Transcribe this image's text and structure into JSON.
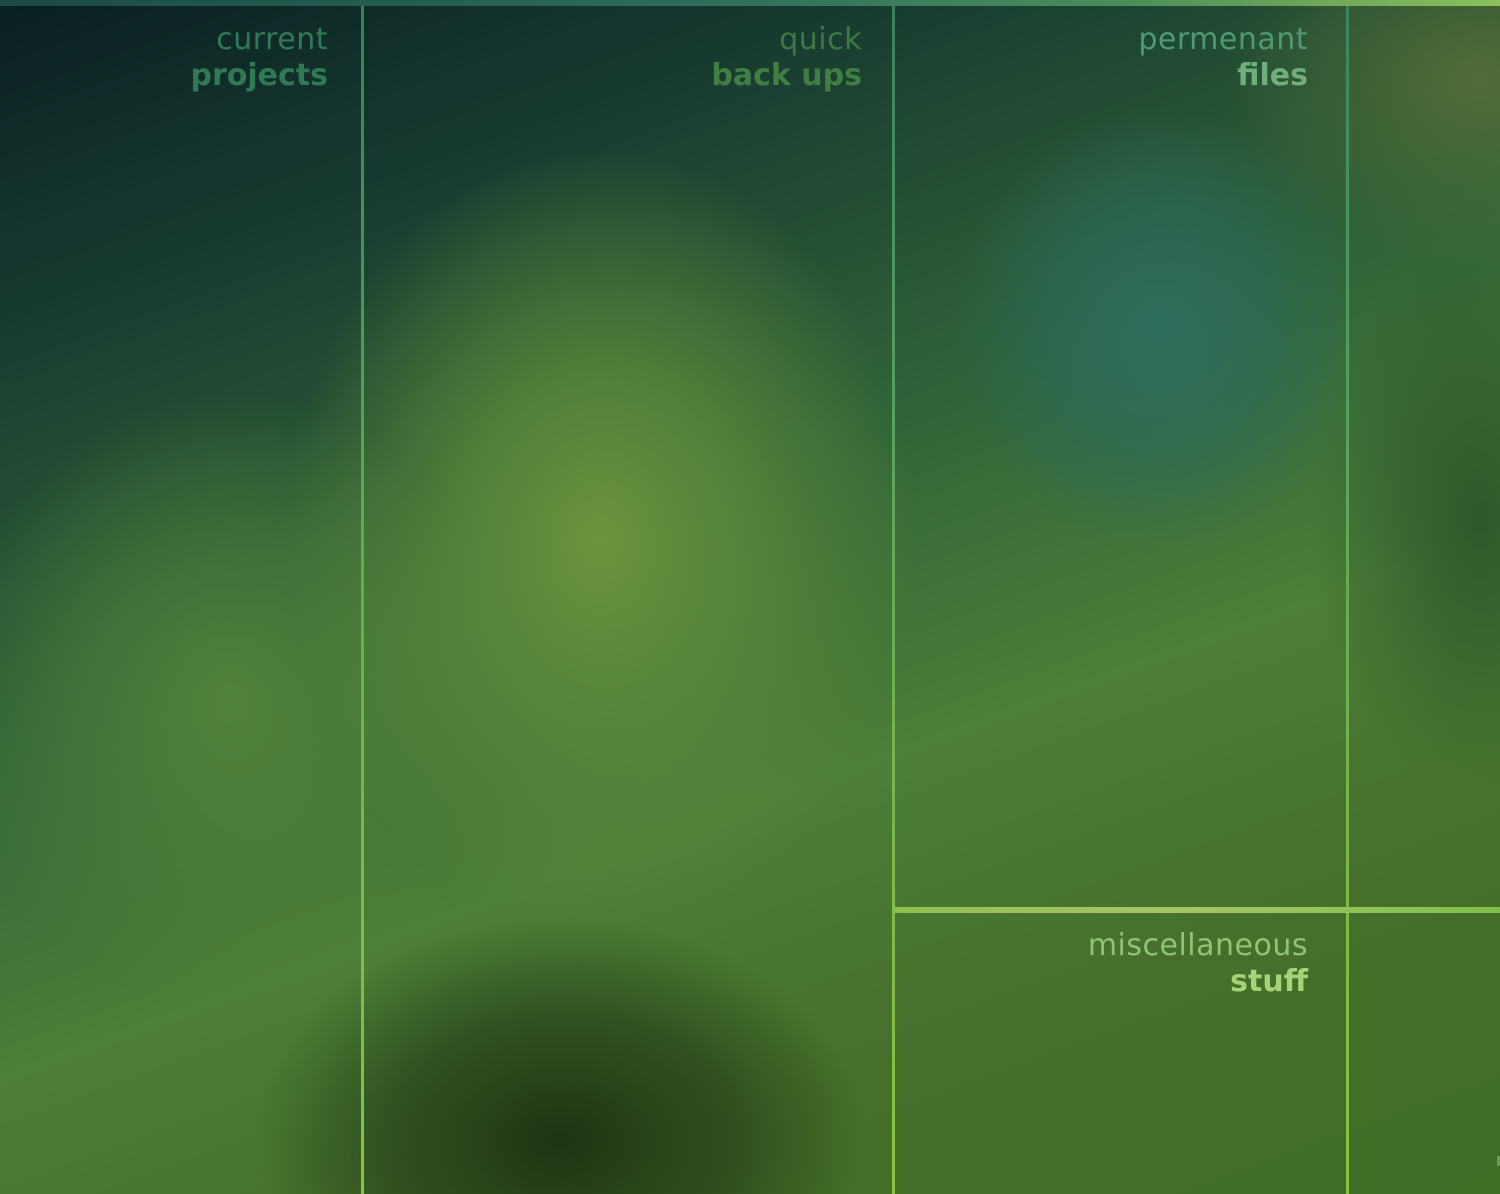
{
  "desktop": {
    "sections": [
      {
        "light": "current",
        "bold": "projects"
      },
      {
        "light": "quick",
        "bold": "back ups"
      },
      {
        "light": "permenant",
        "bold": "files"
      },
      {
        "light": "miscellaneous",
        "bold": "stuff"
      }
    ]
  },
  "colors": {
    "label_dark": "#2f7a52",
    "label_bright": "#a7d27a",
    "divider": "#7fc04a"
  }
}
